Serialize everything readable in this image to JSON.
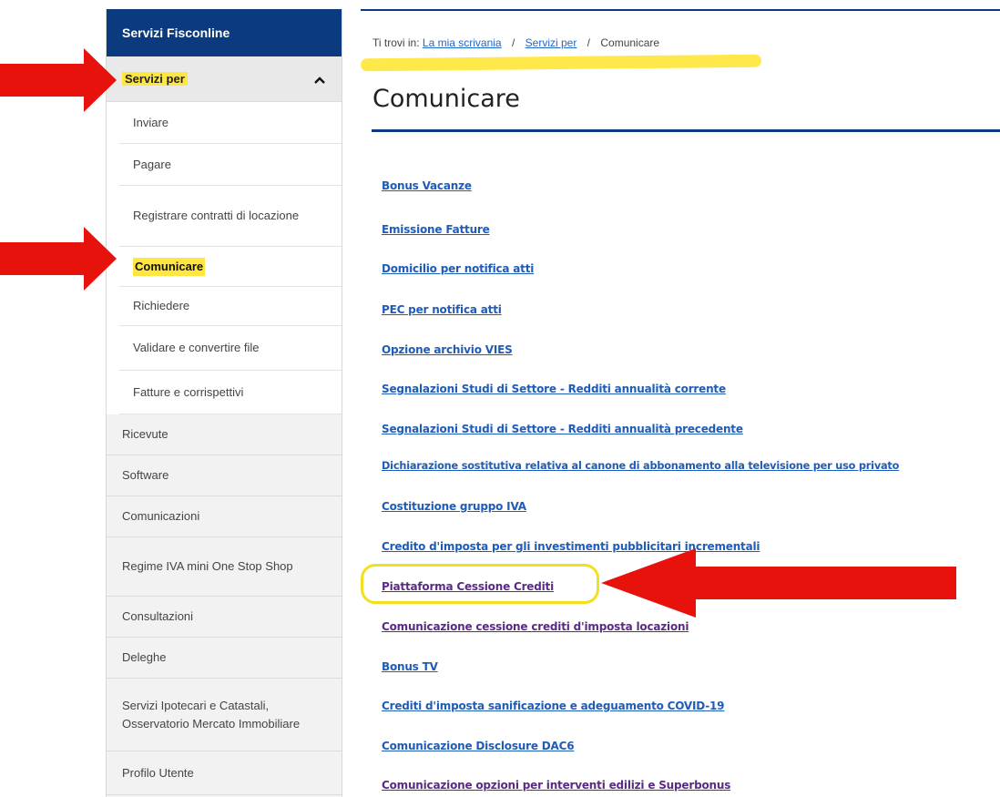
{
  "sidebar": {
    "header": "Servizi Fisconline",
    "open_section": {
      "label": "Servizi per",
      "chevron_icon": "chevron-up-icon"
    },
    "sub_items": [
      {
        "label": "Inviare"
      },
      {
        "label": "Pagare"
      },
      {
        "label": "Registrare contratti di locazione"
      },
      {
        "label": "Comunicare",
        "active": true
      },
      {
        "label": "Richiedere"
      },
      {
        "label": "Validare e convertire file"
      },
      {
        "label": "Fatture e corrispettivi"
      }
    ],
    "items": [
      {
        "label": "Ricevute"
      },
      {
        "label": "Software"
      },
      {
        "label": "Comunicazioni"
      },
      {
        "label": "Regime IVA mini One Stop Shop"
      },
      {
        "label": "Consultazioni"
      },
      {
        "label": "Deleghe"
      },
      {
        "label": "Servizi Ipotecari e Catastali, Osservatorio Mercato Immobiliare"
      },
      {
        "label": "Profilo Utente"
      }
    ]
  },
  "breadcrumb": {
    "prefix": "Ti trovi in:",
    "link1": "La mia scrivania",
    "link2": "Servizi per",
    "separator": "/",
    "current": "Comunicare"
  },
  "page_title": "Comunicare",
  "links": [
    {
      "label": "Bonus Vacanze"
    },
    {
      "label": "Emissione Fatture"
    },
    {
      "label": "Domicilio per notifica atti"
    },
    {
      "label": "PEC per notifica atti"
    },
    {
      "label": "Opzione archivio VIES"
    },
    {
      "label": "Segnalazioni Studi di Settore - Redditi annualità corrente"
    },
    {
      "label": "Segnalazioni Studi di Settore - Redditi annualità precedente"
    },
    {
      "label": "Dichiarazione sostitutiva relativa al canone di abbonamento alla televisione per uso privato"
    },
    {
      "label": "Costituzione gruppo IVA"
    },
    {
      "label": "Credito d'imposta per gli investimenti pubblicitari incrementali"
    },
    {
      "label": "Piattaforma Cessione Crediti",
      "visited": true
    },
    {
      "label": "Comunicazione cessione crediti d'imposta locazioni",
      "visited": true
    },
    {
      "label": "Bonus TV"
    },
    {
      "label": "Crediti d'imposta sanificazione e adeguamento COVID-19"
    },
    {
      "label": "Comunicazione Disclosure DAC6"
    },
    {
      "label": "Comunicazione opzioni per interventi edilizi e Superbonus",
      "visited": true
    }
  ],
  "colors": {
    "header_blue": "#0b3a7e",
    "link_blue": "#1f5cb8",
    "visited_purple": "#5b2a86",
    "highlight_yellow": "#ffe640",
    "arrow_red": "#e8120c"
  }
}
